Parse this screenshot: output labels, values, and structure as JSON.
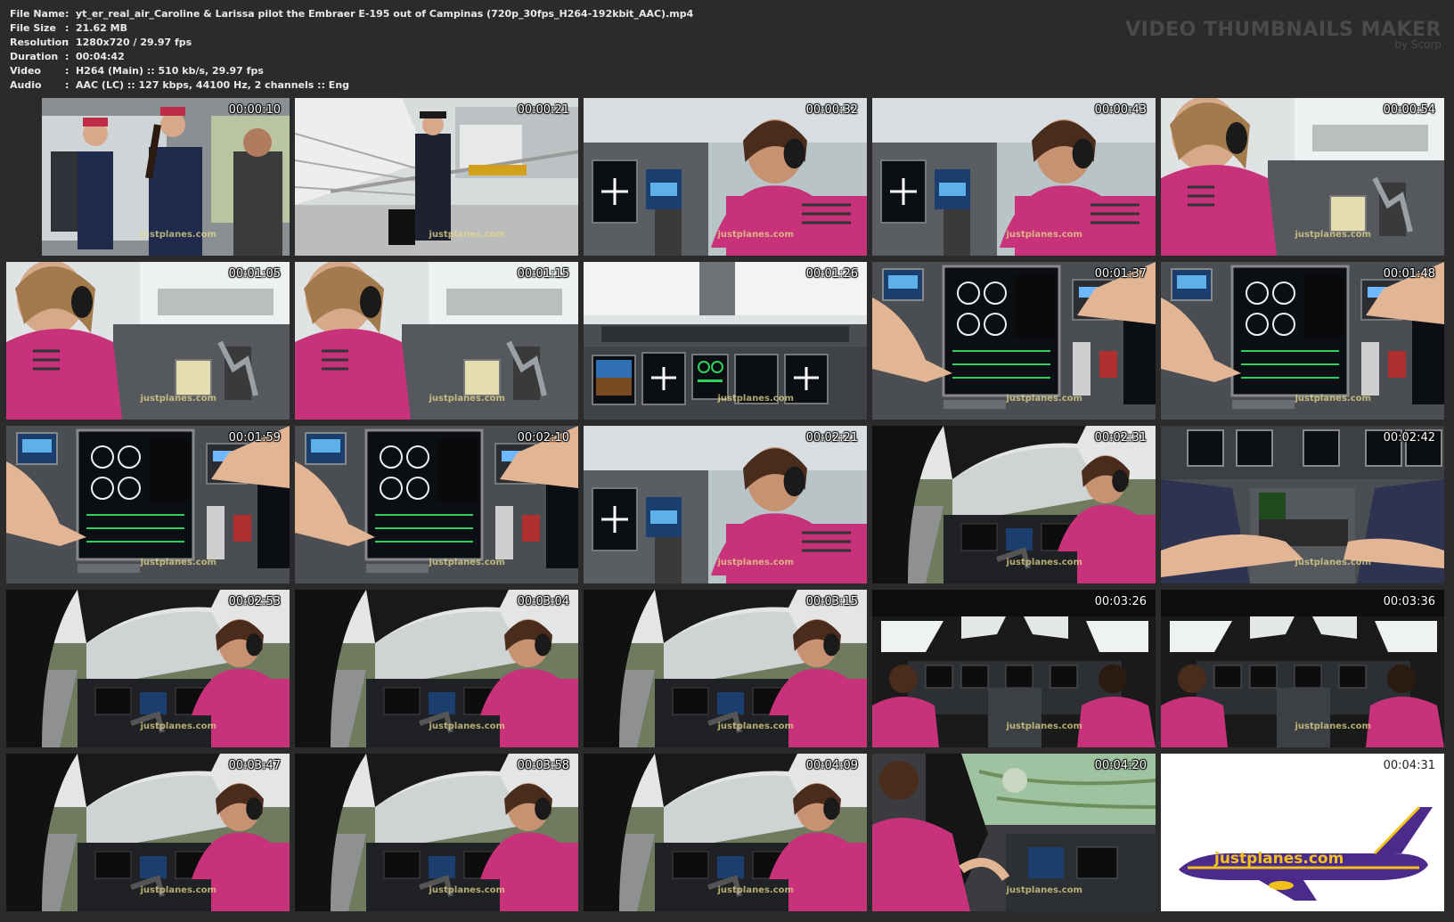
{
  "file_info": [
    {
      "key": "File Name",
      "sep": ":",
      "value": "yt_er_real_air_Caroline & Larissa pilot the Embraer E-195 out of Campinas (720p_30fps_H264-192kbit_AAC).mp4"
    },
    {
      "key": "File Size",
      "sep": ":",
      "value": "21.62 MB"
    },
    {
      "key": "Resolution",
      "sep": ":",
      "value": "1280x720 / 29.97 fps"
    },
    {
      "key": "Duration",
      "sep": ":",
      "value": "00:04:42"
    },
    {
      "key": "Video",
      "sep": ":",
      "value": "H264 (Main) :: 510 kb/s, 29.97 fps"
    },
    {
      "key": "Audio",
      "sep": ":",
      "value": "AAC (LC) :: 127 kbps, 44100 Hz, 2 channels :: Eng"
    }
  ],
  "brand": {
    "title": "VIDEO THUMBNAILS MAKER",
    "subtitle": "by Scorp"
  },
  "watermark": "justplanes.com",
  "logo_text": "justplanes.com",
  "thumbnails": [
    {
      "time": "00:00:10",
      "scene": "van"
    },
    {
      "time": "00:00:21",
      "scene": "stairs"
    },
    {
      "time": "00:00:32",
      "scene": "cockpit-closeup"
    },
    {
      "time": "00:00:43",
      "scene": "cockpit-closeup"
    },
    {
      "time": "00:00:54",
      "scene": "pilot-side"
    },
    {
      "time": "00:01:05",
      "scene": "pilot-side"
    },
    {
      "time": "00:01:15",
      "scene": "pilot-side"
    },
    {
      "time": "00:01:26",
      "scene": "panel-wide"
    },
    {
      "time": "00:01:37",
      "scene": "panel-hand"
    },
    {
      "time": "00:01:48",
      "scene": "panel-hand"
    },
    {
      "time": "00:01:59",
      "scene": "panel-hand"
    },
    {
      "time": "00:02:10",
      "scene": "panel-hand"
    },
    {
      "time": "00:02:21",
      "scene": "cockpit-closeup"
    },
    {
      "time": "00:02:31",
      "scene": "runway"
    },
    {
      "time": "00:02:42",
      "scene": "throttle"
    },
    {
      "time": "00:02:53",
      "scene": "runway"
    },
    {
      "time": "00:03:04",
      "scene": "runway"
    },
    {
      "time": "00:03:15",
      "scene": "runway"
    },
    {
      "time": "00:03:26",
      "scene": "cockpit-wide"
    },
    {
      "time": "00:03:36",
      "scene": "cockpit-wide"
    },
    {
      "time": "00:03:47",
      "scene": "runway"
    },
    {
      "time": "00:03:58",
      "scene": "runway"
    },
    {
      "time": "00:04:09",
      "scene": "runway"
    },
    {
      "time": "00:04:20",
      "scene": "aerial"
    },
    {
      "time": "00:04:31",
      "scene": "logo"
    }
  ],
  "colors": {
    "background": "#2b2b2b",
    "info_text": "#e9e9e9",
    "brand_text": "#4a4a4a",
    "uniform_pink": "#c8327a",
    "uniform_navy": "#1f2a4d",
    "panel_gray": "#55595e",
    "screen_black": "#0b0f14",
    "logo_purple": "#4b2a8c",
    "logo_yellow": "#f2c21b"
  }
}
